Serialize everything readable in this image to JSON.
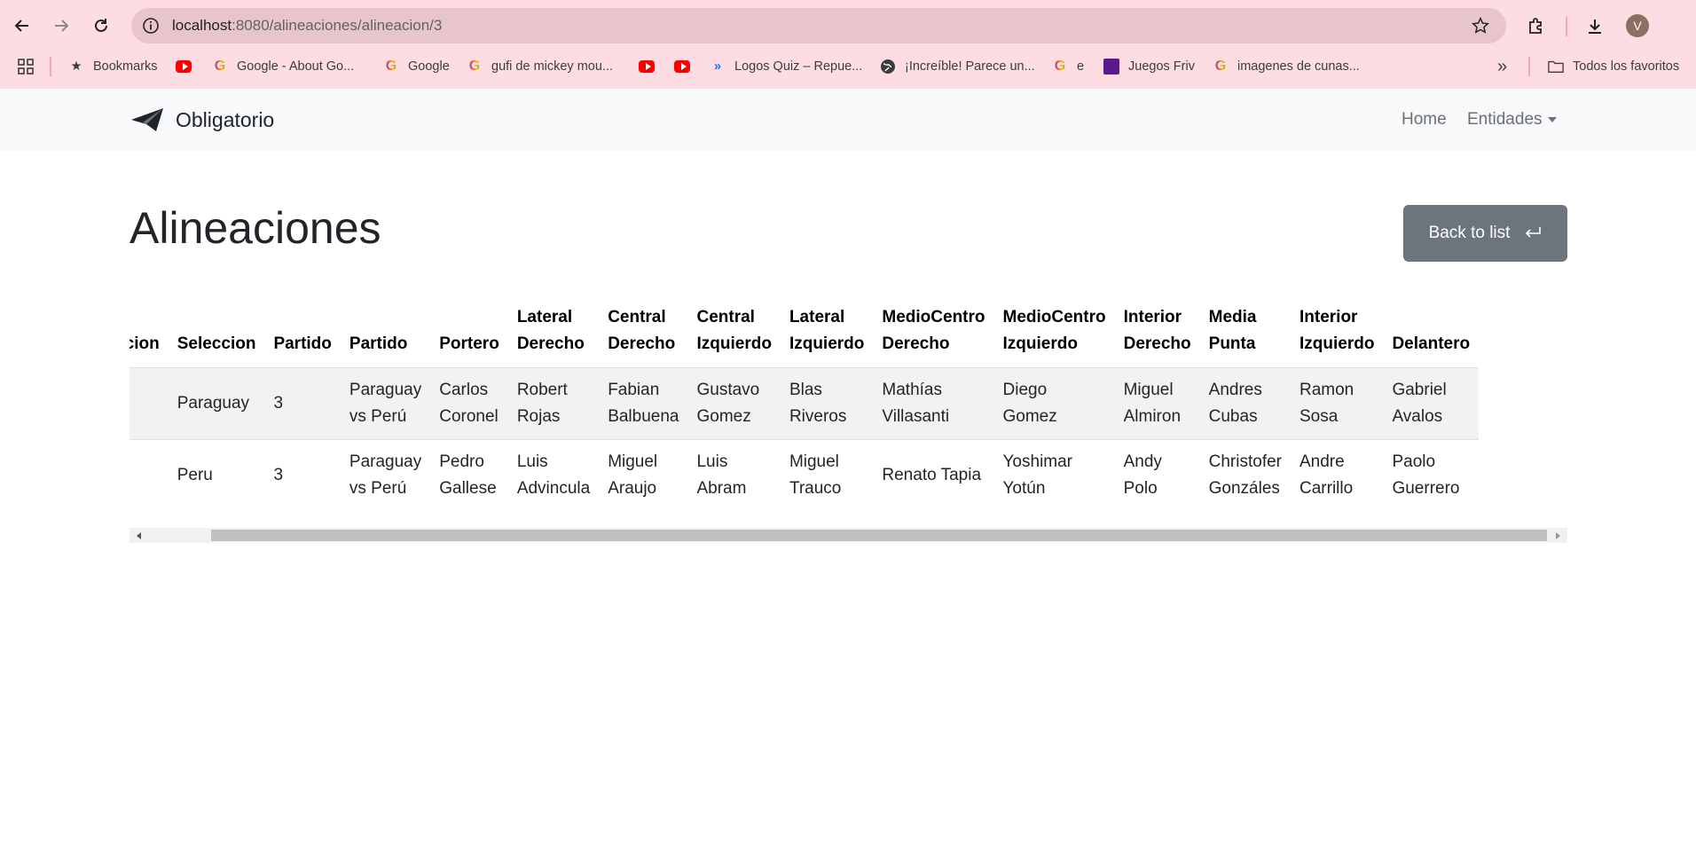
{
  "browser": {
    "url_host": "localhost",
    "url_path": ":8080/alineaciones/alineacion/3",
    "avatar_letter": "V",
    "bookmarks": [
      {
        "label": "Bookmarks",
        "icon": "star-icon"
      },
      {
        "label": "",
        "icon": "youtube-icon"
      },
      {
        "label": "Google - About Go...",
        "icon": "google-icon"
      },
      {
        "label": "Google",
        "icon": "google-icon"
      },
      {
        "label": "gufi de mickey mou...",
        "icon": "google-icon"
      },
      {
        "label": "",
        "icon": "youtube-icon"
      },
      {
        "label": "",
        "icon": "youtube-icon"
      },
      {
        "label": "Logos Quiz – Repue...",
        "icon": "chevrons-icon"
      },
      {
        "label": "¡Increíble! Parece un...",
        "icon": "globe-icon"
      },
      {
        "label": "e",
        "icon": "google-icon"
      },
      {
        "label": "Juegos Friv",
        "icon": "friv-icon"
      },
      {
        "label": "imagenes de cunas...",
        "icon": "google-icon"
      }
    ],
    "all_bookmarks_label": "Todos los favoritos"
  },
  "navbar": {
    "brand": "Obligatorio",
    "home": "Home",
    "entidades": "Entidades"
  },
  "page": {
    "title": "Alineaciones",
    "back_button": "Back to list"
  },
  "table": {
    "headers": [
      [
        "Seleccion"
      ],
      [
        "Seleccion"
      ],
      [
        "Partido"
      ],
      [
        "Partido"
      ],
      [
        "Portero"
      ],
      [
        "Lateral",
        "Derecho"
      ],
      [
        "Central",
        "Derecho"
      ],
      [
        "Central",
        "Izquierdo"
      ],
      [
        "Lateral",
        "Izquierdo"
      ],
      [
        "MedioCentro",
        "Derecho"
      ],
      [
        "MedioCentro",
        "Izquierdo"
      ],
      [
        "Interior",
        "Derecho"
      ],
      [
        "Media",
        "Punta"
      ],
      [
        "Interior",
        "Izquierdo"
      ],
      [
        "Delantero"
      ]
    ],
    "rows": [
      [
        "",
        "Paraguay",
        "3",
        "Paraguay vs Perú",
        "Carlos Coronel",
        "Robert Rojas",
        "Fabian Balbuena",
        "Gustavo Gomez",
        "Blas Riveros",
        "Mathías Villasanti",
        "Diego Gomez",
        "Miguel Almiron",
        "Andres Cubas",
        "Ramon Sosa",
        "Gabriel Avalos"
      ],
      [
        "",
        "Peru",
        "3",
        "Paraguay vs Perú",
        "Pedro Gallese",
        "Luis Advincula",
        "Miguel Araujo",
        "Luis Abram",
        "Miguel Trauco",
        "Renato Tapia",
        "Yoshimar Yotún",
        "Andy Polo",
        "Christofer Gonzáles",
        "Andre Carrillo",
        "Paolo Guerrero"
      ]
    ]
  }
}
